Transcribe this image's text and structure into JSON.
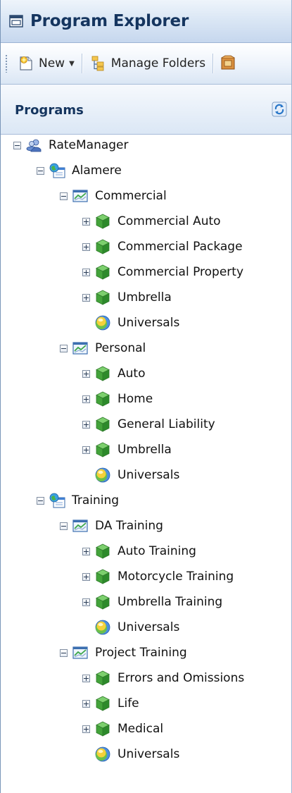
{
  "window": {
    "title": "Program Explorer"
  },
  "toolbar": {
    "new_label": "New",
    "manage_folders_label": "Manage Folders"
  },
  "panel": {
    "title": "Programs"
  },
  "tree": {
    "root": "RateManager",
    "groups": [
      {
        "label": "Alamere",
        "folders": [
          {
            "label": "Commercial",
            "programs": [
              "Commercial Auto",
              "Commercial Package",
              "Commercial Property",
              "Umbrella"
            ],
            "universals": "Universals"
          },
          {
            "label": "Personal",
            "programs": [
              "Auto",
              "Home",
              "General Liability",
              "Umbrella"
            ],
            "universals": "Universals"
          }
        ]
      },
      {
        "label": "Training",
        "folders": [
          {
            "label": "DA Training",
            "programs": [
              "Auto Training",
              "Motorcycle Training",
              "Umbrella Training"
            ],
            "universals": "Universals"
          },
          {
            "label": "Project Training",
            "programs": [
              "Errors and Omissions",
              "Life",
              "Medical"
            ],
            "universals": "Universals"
          }
        ]
      }
    ]
  }
}
